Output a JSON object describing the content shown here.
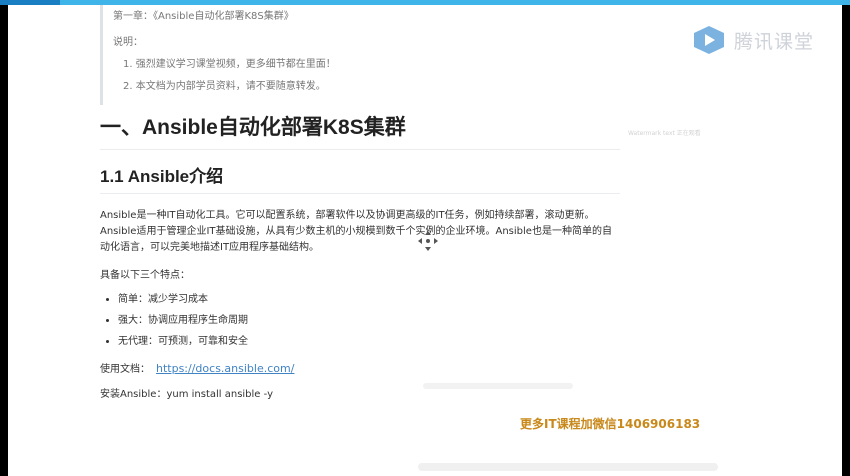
{
  "watermark": {
    "logo_text": "腾讯课堂",
    "side_text": "Watermark text 正在观看"
  },
  "document": {
    "quote": {
      "title": "第一章：《Ansible自动化部署K8S集群》",
      "label": "说明：",
      "items": [
        "1. 强烈建议学习课堂视频，更多细节都在里面！",
        "2. 本文档为内部学员资料，请不要随意转发。"
      ]
    },
    "h1": "一、Ansible自动化部署K8S集群",
    "h2": "1.1 Ansible介绍",
    "intro": "Ansible是一种IT自动化工具。它可以配置系统，部署软件以及协调更高级的IT任务，例如持续部署，滚动更新。Ansible适用于管理企业IT基础设施，从具有少数主机的小规模到数千个实例的企业环境。Ansible也是一种简单的自动化语言，可以完美地描述IT应用程序基础结构。",
    "features_label": "具备以下三个特点：",
    "features": [
      "简单：减少学习成本",
      "强大：协调应用程序生命周期",
      "无代理：可预测，可靠和安全"
    ],
    "docs_label": "使用文档：",
    "docs_link": "https://docs.ansible.com/",
    "install": "安装Ansible：yum install ansible -y"
  },
  "overlay": {
    "promo": "更多IT课程加微信1406906183"
  },
  "colors": {
    "top_accent": "#3fb4e8",
    "link": "#4183c4",
    "promo": "#c9881a"
  },
  "icons": {
    "logo": "tencent-classroom-play-icon",
    "move": "move-cursor-icon"
  }
}
